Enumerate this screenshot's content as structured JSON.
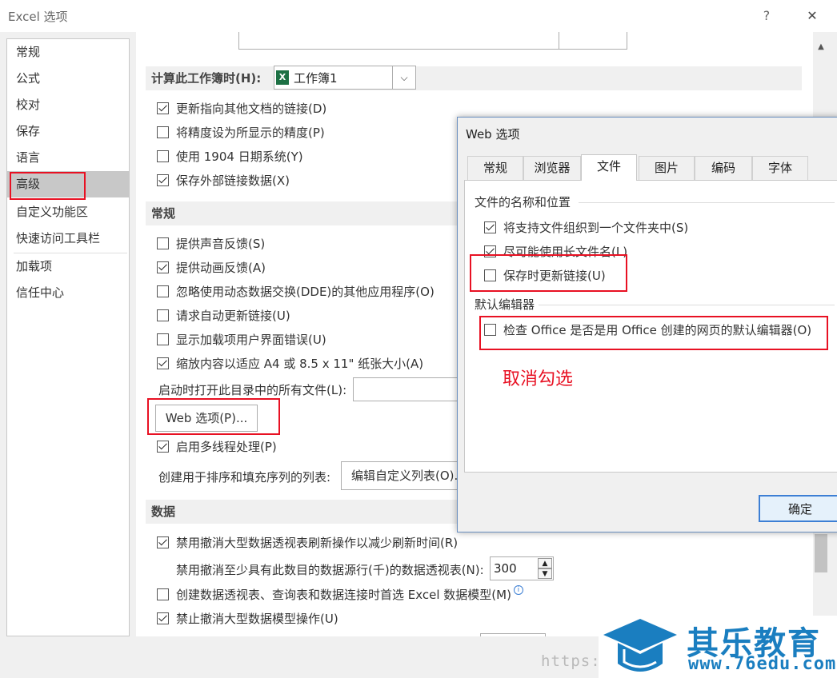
{
  "window": {
    "title": "Excel 选项",
    "help": "?",
    "close": "✕"
  },
  "sidebar": {
    "items": [
      {
        "label": "常规"
      },
      {
        "label": "公式"
      },
      {
        "label": "校对"
      },
      {
        "label": "保存"
      },
      {
        "label": "语言"
      },
      {
        "label": "高级"
      },
      {
        "label": "自定义功能区"
      },
      {
        "label": "快速访问工具栏"
      },
      {
        "label": "加载项"
      },
      {
        "label": "信任中心"
      }
    ],
    "active": "高级"
  },
  "workbook_calc": {
    "header": "计算此工作簿时(H):",
    "selected": "工作簿1",
    "options": [
      {
        "label": "更新指向其他文档的链接(D)",
        "checked": true
      },
      {
        "label": "将精度设为所显示的精度(P)",
        "checked": false
      },
      {
        "label": "使用 1904 日期系统(Y)",
        "checked": false
      },
      {
        "label": "保存外部链接数据(X)",
        "checked": true
      }
    ]
  },
  "general": {
    "header": "常规",
    "options": [
      {
        "label": "提供声音反馈(S)",
        "checked": false
      },
      {
        "label": "提供动画反馈(A)",
        "checked": true
      },
      {
        "label": "忽略使用动态数据交换(DDE)的其他应用程序(O)",
        "checked": false
      },
      {
        "label": "请求自动更新链接(U)",
        "checked": false
      },
      {
        "label": "显示加载项用户界面错误(U)",
        "checked": false
      },
      {
        "label": "缩放内容以适应 A4 或 8.5 x 11\" 纸张大小(A)",
        "checked": true
      }
    ],
    "startup_label": "启动时打开此目录中的所有文件(L):",
    "web_options_button": "Web 选项(P)...",
    "multithread": {
      "label": "启用多线程处理(P)",
      "checked": true
    },
    "custom_list_label": "创建用于排序和填充序列的列表:",
    "custom_list_button": "编辑自定义列表(O)..."
  },
  "data": {
    "header": "数据",
    "options": [
      {
        "label": "禁用撤消大型数据透视表刷新操作以减少刷新时间(R)",
        "checked": true
      },
      {
        "label": "创建数据透视表、查询表和数据连接时首选 Excel 数据模型(M)",
        "checked": false
      },
      {
        "label": "禁止撤消大型数据模型操作(U)",
        "checked": true
      }
    ],
    "pivot_rows_label": "禁用撤消至少具有此数目的数据源行(千)的数据透视表(N):",
    "pivot_rows_value": "300",
    "info": "i"
  },
  "web_dialog": {
    "title": "Web 选项",
    "tabs": [
      "常规",
      "浏览器",
      "文件",
      "图片",
      "编码",
      "字体"
    ],
    "active_tab": "文件",
    "group1_title": "文件的名称和位置",
    "group1_options": [
      {
        "label": "将支持文件组织到一个文件夹中(S)",
        "checked": true
      },
      {
        "label": "尽可能使用长文件名(L)",
        "checked": true
      },
      {
        "label": "保存时更新链接(U)",
        "checked": false
      }
    ],
    "group2_title": "默认编辑器",
    "group2_options": [
      {
        "label": "检查 Office 是否是用 Office 创建的网页的默认编辑器(O)",
        "checked": false
      }
    ],
    "ok_button": "确定"
  },
  "annotation": "取消勾选",
  "watermark": {
    "url": "https://",
    "brand": "其乐教育",
    "site": "www.76edu.com"
  },
  "colors": {
    "annotation_red": "#e81123",
    "brand_blue": "#1a7ec0",
    "accent_blue": "#3d7fd4"
  }
}
